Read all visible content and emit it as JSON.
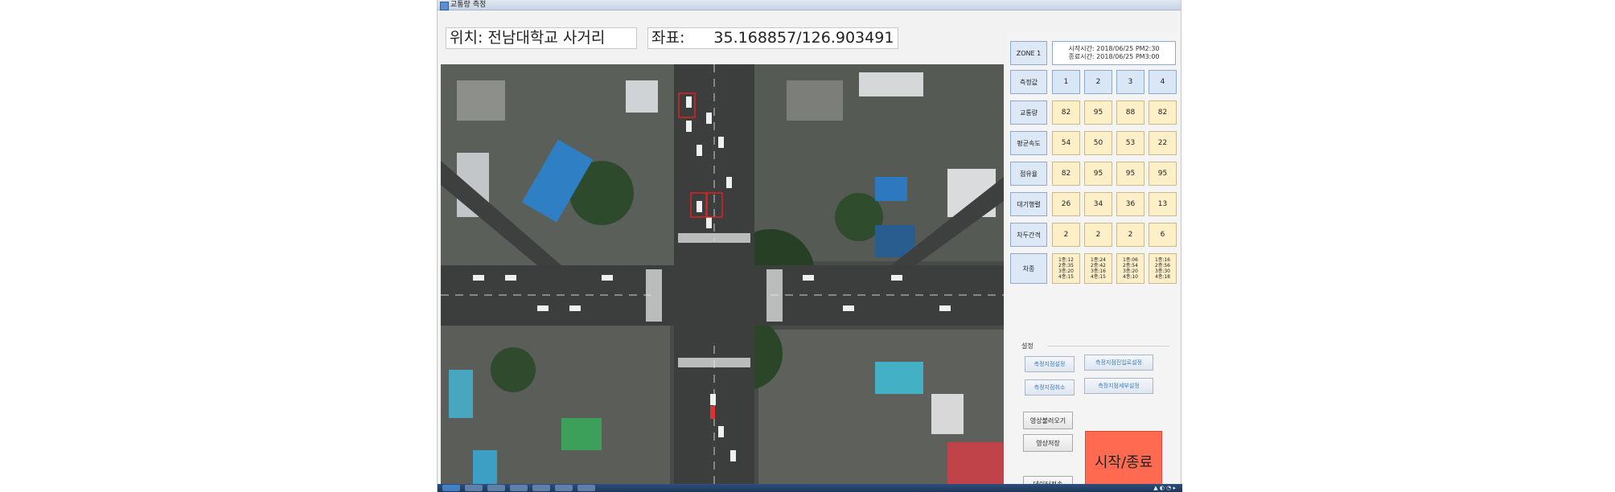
{
  "window": {
    "title": "교통량 측정"
  },
  "location": {
    "label": "위치:",
    "value": "전남대학교 사거리"
  },
  "coords": {
    "label": "좌표:",
    "value": "35.168857/126.903491"
  },
  "zone": {
    "label": "ZONE 1",
    "start": "시작시간: 2018/06/25 PM2:30",
    "end": "종료시간: 2018/06/25 PM3:00"
  },
  "rows": [
    {
      "label": "측정값",
      "values": [
        "1",
        "2",
        "3",
        "4"
      ],
      "style": "blue"
    },
    {
      "label": "교통량",
      "values": [
        "82",
        "95",
        "88",
        "82"
      ],
      "style": "yellow"
    },
    {
      "label": "평균속도",
      "values": [
        "54",
        "50",
        "53",
        "22"
      ],
      "style": "yellow"
    },
    {
      "label": "점유율",
      "values": [
        "82",
        "95",
        "95",
        "95"
      ],
      "style": "yellow"
    },
    {
      "label": "대기행렬",
      "values": [
        "26",
        "34",
        "36",
        "13"
      ],
      "style": "yellow"
    },
    {
      "label": "차두간격",
      "values": [
        "2",
        "2",
        "2",
        "6"
      ],
      "style": "yellow"
    }
  ],
  "vehicle_row": {
    "label": "차종",
    "cells": [
      [
        "1종:12",
        "2종:35",
        "3종:20",
        "4종:15"
      ],
      [
        "1종:24",
        "2종:42",
        "3종:16",
        "4종:15"
      ],
      [
        "1종:06",
        "2종:54",
        "3종:20",
        "4종:10"
      ],
      [
        "1종:16",
        "2종:56",
        "3종:30",
        "4종:18"
      ]
    ]
  },
  "settings": {
    "title": "설정",
    "btn_point_set": "측정지점설정",
    "btn_point_cancel": "측정지점취소",
    "btn_detail_set": "측정지점진입로설정",
    "btn_detail_cancel": "측정지점세부설정",
    "btn_load_video": "영상불러오기",
    "btn_save_video": "영상저장",
    "btn_data_export": "데이터전송",
    "btn_start_stop": "시작/종료"
  },
  "colors": {
    "start_button": "#ff6a50",
    "cell_yellow": "#fdf0c8",
    "cell_blue": "#d9e6f5"
  }
}
